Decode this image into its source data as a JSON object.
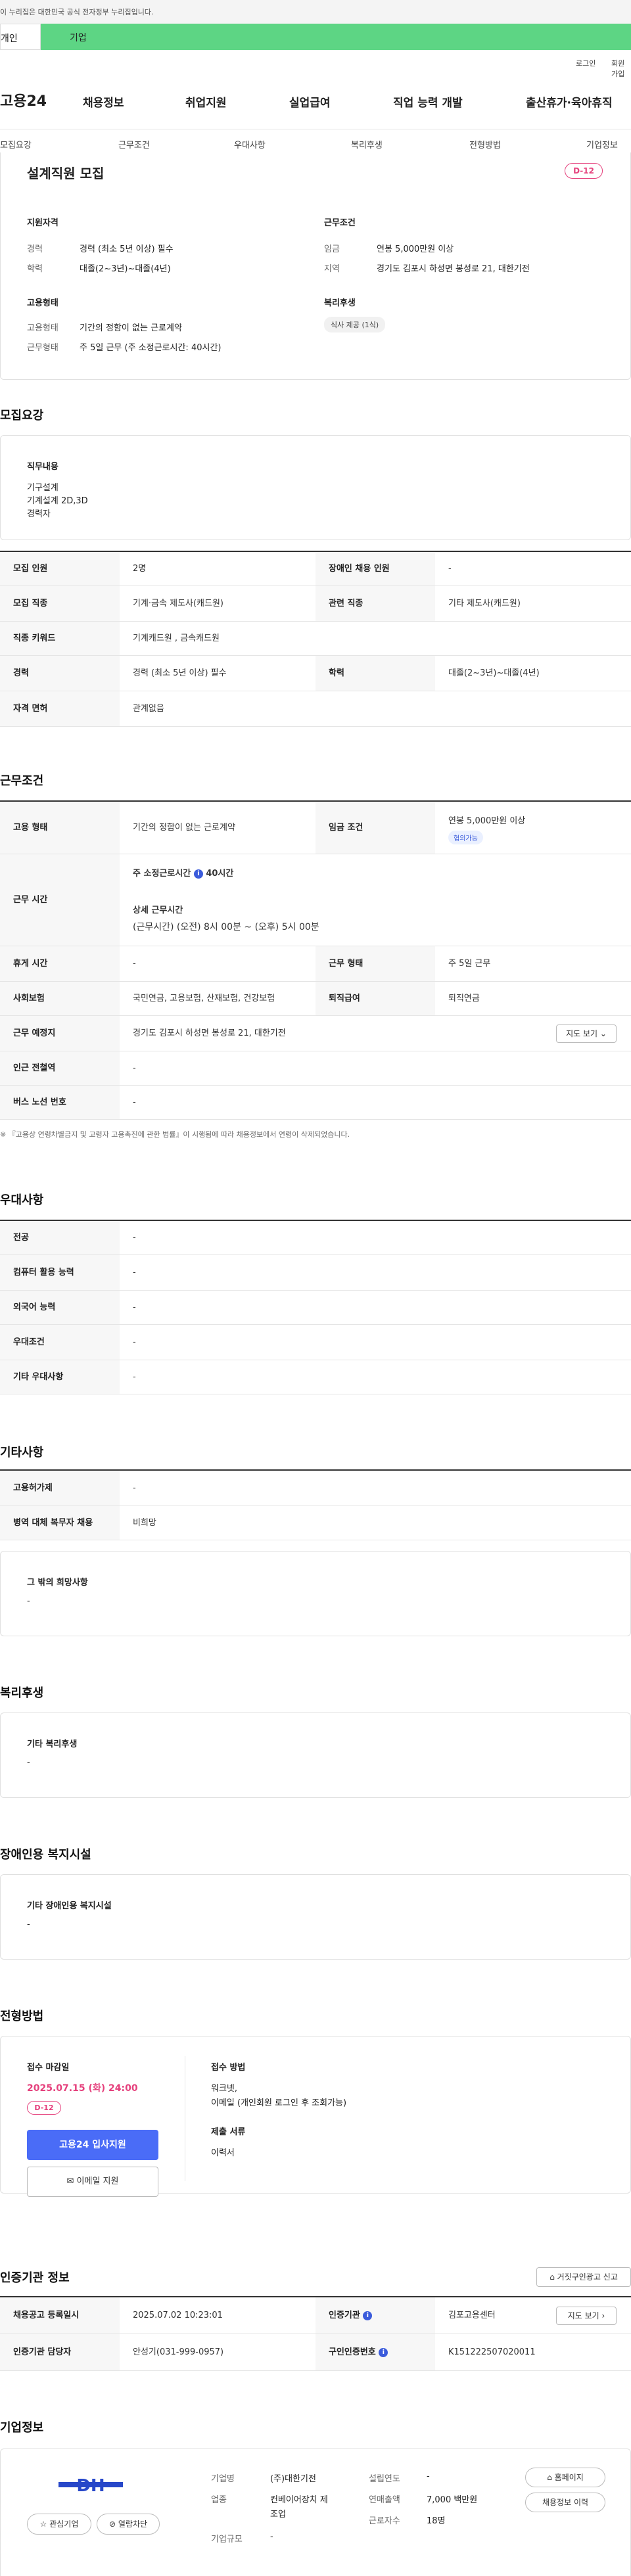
{
  "gov_banner": "이 누리집은 대한민국 공식 전자정부 누리집입니다.",
  "site_tabs": [
    "개인",
    "기업"
  ],
  "util": {
    "login": "로그인",
    "signup": "회원가입"
  },
  "logo": "고용24",
  "gnb": [
    "채용정보",
    "취업지원",
    "실업급여",
    "직업 능력 개발",
    "출산휴가·육아휴직"
  ],
  "subnav": [
    "모집요강",
    "근무조건",
    "우대사항",
    "복리후생",
    "전형방법",
    "기업정보"
  ],
  "summary": {
    "title": "설계직원 모집",
    "dday": "D-12",
    "qual_title": "지원자격",
    "qual": [
      {
        "k": "경력",
        "v": "경력 (최소 5년 이상) 필수"
      },
      {
        "k": "학력",
        "v": "대졸(2~3년)~대졸(4년)"
      }
    ],
    "cond_title": "근무조건",
    "cond": [
      {
        "k": "임금",
        "v": "연봉 5,000만원 이상"
      },
      {
        "k": "지역",
        "v": "경기도 김포시 하성면 봉성로 21, 대한기전"
      }
    ],
    "emp_title": "고용형태",
    "emp": [
      {
        "k": "고용형태",
        "v": "기간의 정함이 없는 근로계약"
      },
      {
        "k": "근무형태",
        "v": "주 5일 근무 (주 소정근로시간: 40시간)"
      }
    ],
    "welfare_title": "복리후생",
    "welfare_chip": "식사 제공 (1식)"
  },
  "recruit": {
    "heading": "모집요강",
    "duty_title": "직무내용",
    "duty_lines": [
      "기구설계",
      "기계설계 2D,3D",
      "경력자"
    ],
    "rows": [
      {
        "k1": "모집 인원",
        "v1": "2명",
        "k2": "장애인 채용 인원",
        "v2": "-"
      },
      {
        "k1": "모집 직종",
        "v1": "기계·금속 제도사(캐드원)",
        "k2": "관련 직종",
        "v2": "기타 제도사(캐드원)"
      },
      {
        "k1": "직종 키워드",
        "v1": "기계캐드원 , 금속캐드원",
        "k2": "",
        "v2": ""
      },
      {
        "k1": "경력",
        "v1": "경력 (최소 5년 이상) 필수",
        "k2": "학력",
        "v2": "대졸(2~3년)~대졸(4년)"
      },
      {
        "k1": "자격 면허",
        "v1": "관계없음",
        "k2": "",
        "v2": ""
      }
    ]
  },
  "work": {
    "heading": "근무조건",
    "emp_k": "고용 형태",
    "emp_v": "기간의 정함이 없는 근로계약",
    "wage_k": "임금 조건",
    "wage_v": "연봉 5,000만원 이상",
    "wage_chip": "협의가능",
    "hours_k": "근무 시간",
    "hours_weekly_label": "주 소정근로시간",
    "hours_weekly": "40시간",
    "hours_detail_label": "상세 근무시간",
    "hours_detail": "(근무시간) (오전) 8시 00분 ~ (오후) 5시 00분",
    "rest_k": "휴게 시간",
    "rest_v": "-",
    "type_k": "근무 형태",
    "type_v": "주 5일 근무",
    "ins_k": "사회보험",
    "ins_v": "국민연금, 고용보험, 산재보험, 건강보험",
    "ret_k": "퇴직급여",
    "ret_v": "퇴직연금",
    "place_k": "근무 예정지",
    "place_v": "경기도 김포시 하성면 봉성로 21, 대한기전",
    "map_btn": "지도 보기",
    "sub_k": "인근 전철역",
    "sub_v": "-",
    "bus_k": "버스 노선 번호",
    "bus_v": "-",
    "note": "※ 『고용상 연령차별금지 및 고령자 고용촉진에 관한 법률』이 시행됨에 따라 채용정보에서 연령이 삭제되었습니다."
  },
  "pref": {
    "heading": "우대사항",
    "rows": [
      {
        "k": "전공",
        "v": "-"
      },
      {
        "k": "컴퓨터 활용 능력",
        "v": "-"
      },
      {
        "k": "외국어 능력",
        "v": "-"
      },
      {
        "k": "우대조건",
        "v": "-"
      },
      {
        "k": "기타 우대사항",
        "v": "-"
      }
    ]
  },
  "etc": {
    "heading": "기타사항",
    "rows": [
      {
        "k": "고용허가제",
        "v": "-"
      },
      {
        "k": "병역 대체 복무자 채용",
        "v": "비희망"
      }
    ],
    "other_title": "그 밖의 희망사항",
    "other_v": "-"
  },
  "welfare": {
    "heading": "복리후생",
    "title": "기타 복리후생",
    "v": "-"
  },
  "disabled": {
    "heading": "장애인용 복지시설",
    "title": "기타 장애인용 복지시설",
    "v": "-"
  },
  "process": {
    "heading": "전형방법",
    "deadline_label": "접수 마감일",
    "deadline": "2025.07.15 (화) 24:00",
    "dday": "D-12",
    "apply_btn": "고용24 입사지원",
    "email_btn": "이메일 지원",
    "method_label": "접수 방법",
    "method_lines": [
      "워크넷,",
      "이메일 (개인회원 로그인 후 조회가능)"
    ],
    "docs_label": "제출 서류",
    "docs": "이력서"
  },
  "cert": {
    "heading": "인증기관 정보",
    "report_btn": "거짓구인광고 신고",
    "r1": {
      "k1": "채용공고 등록일시",
      "v1": "2025.07.02 10:23:01",
      "k2": "인증기관",
      "v2": "김포고용센터",
      "btn": "지도 보기"
    },
    "r2": {
      "k1": "인증기관 담당자",
      "v1": "안성기(031-999-0957)",
      "k2": "구인인증번호",
      "v2": "K151222507020011"
    }
  },
  "company": {
    "heading": "기업정보",
    "logo_text": "DH",
    "fav_btn": "관심기업",
    "block_btn": "열람차단",
    "name_k": "기업명",
    "name_v": "(주)대한기전",
    "ind_k": "업종",
    "ind_v1": "컨베이어장치 제",
    "ind_v2": "조업",
    "size_k": "기업규모",
    "size_v": "-",
    "year_k": "설립연도",
    "year_v": "-",
    "sales_k": "연매출액",
    "sales_v": "7,000 백만원",
    "emp_k": "근로자수",
    "emp_v": "18명",
    "home_btn": "홈페이지",
    "hist_btn": "채용정보 이력"
  },
  "colors": {
    "accent": "#4a6cf7",
    "dday": "#e5407c",
    "tab_green": "#5dd584"
  }
}
